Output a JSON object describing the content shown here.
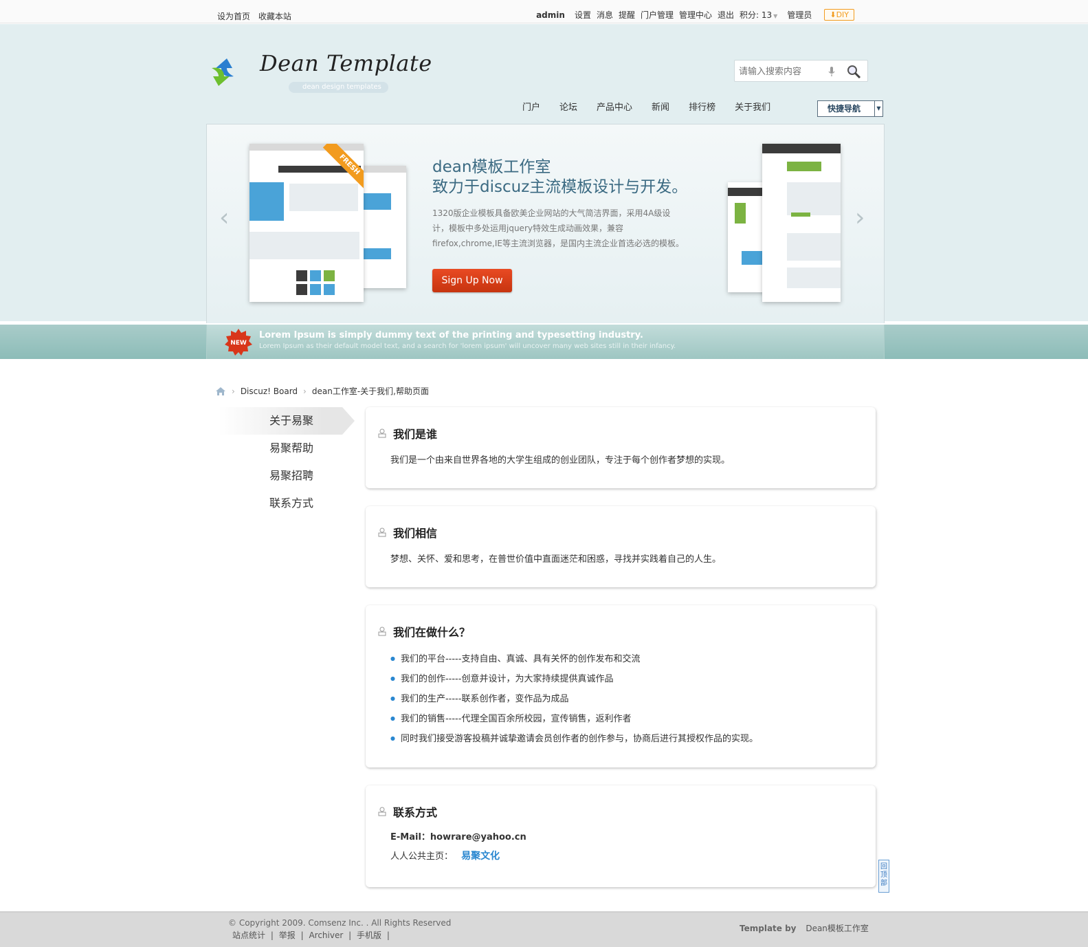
{
  "topbar": {
    "left": [
      "设为首页",
      "收藏本站"
    ],
    "user": "admin",
    "links": [
      "设置",
      "消息",
      "提醒",
      "门户管理",
      "管理中心",
      "退出"
    ],
    "credit": "积分: 13",
    "group": "管理员",
    "diy": "DIY"
  },
  "header": {
    "logo_text": "Dean Template",
    "logo_sub": "dean design templates",
    "search_placeholder": "请输入搜索内容",
    "nav": [
      "门户",
      "论坛",
      "产品中心",
      "新闻",
      "排行榜",
      "关于我们"
    ],
    "quick_nav": "快捷导航"
  },
  "slide": {
    "title1": "dean模板工作室",
    "title2": "致力于discuz主流模板设计与开发。",
    "desc": "1320版企业模板具备欧美企业网站的大气简洁界面，采用4A级设计，模板中多处运用jquery特效生成动画效果，兼容firefox,chrome,IE等主流浏览器，是国内主流企业首选必选的模板。",
    "button": "Sign Up Now",
    "ribbon": "FRESH"
  },
  "band": {
    "badge": "NEW",
    "headline": "Lorem Ipsum is simply dummy text of the printing and typesetting industry.",
    "sub": "Lorem Ipsum as their default model text, and a search for 'lorem ipsum' will uncover many web sites still in their infancy."
  },
  "breadcrumb": [
    "Discuz! Board",
    "dean工作室-关于我们,帮助页面"
  ],
  "left_menu": [
    "关于易聚",
    "易聚帮助",
    "易聚招聘",
    "联系方式"
  ],
  "sections": {
    "who": {
      "title": "我们是谁",
      "text": "我们是一个由来自世界各地的大学生组成的创业团队，专注于每个创作者梦想的实现。"
    },
    "believe": {
      "title": "我们相信",
      "text": "梦想、关怀、爱和思考，在普世价值中直面迷茫和困惑，寻找并实践着自己的人生。"
    },
    "doing": {
      "title": "我们在做什么？",
      "items": [
        "我们的平台-----支持自由、真诚、具有关怀的创作发布和交流",
        "我们的创作-----创意并设计，为大家持续提供真诚作品",
        "我们的生产-----联系创作者，变作品为成品",
        "我们的销售-----代理全国百余所校园，宣传销售，返利作者",
        "同时我们接受游客投稿并诚挚邀请会员创作者的创作参与，协商后进行其授权作品的实现。"
      ]
    },
    "contact": {
      "title": "联系方式",
      "email": "E-Mail：howrare@yahoo.cn",
      "home_label": "人人公共主页：",
      "home_link": "易聚文化"
    }
  },
  "totop": "回顶部",
  "footer": {
    "copyright": "© Copyright 2009.  Comsenz Inc.  . All Rights Reserved",
    "links": [
      "站点统计",
      "|",
      "举报",
      "|",
      "Archiver",
      "|",
      "手机版",
      "|"
    ],
    "template_by": "Template by",
    "studio": "Dean模板工作室"
  }
}
